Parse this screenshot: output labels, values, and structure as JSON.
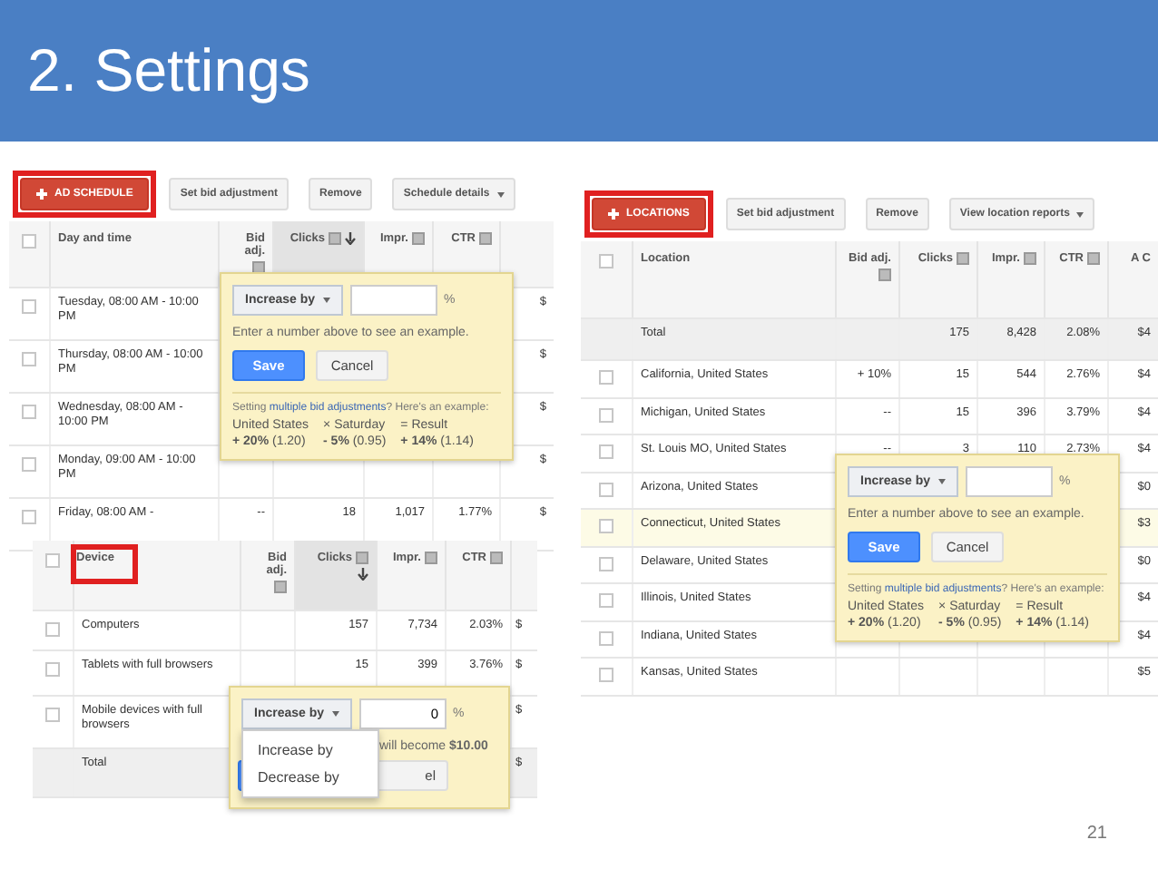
{
  "slide": {
    "title": "2. Settings",
    "page_number": "21"
  },
  "panels": [
    {
      "kind": "schedule",
      "toolbar": [
        {
          "label": "AD SCHEDULE",
          "kind": "add",
          "highlighted": true
        },
        {
          "label": "Set bid adjustment",
          "kind": "plain",
          "highlighted": false
        },
        {
          "label": "Remove",
          "kind": "plain",
          "highlighted": false
        },
        {
          "label": "Schedule details",
          "kind": "menu",
          "highlighted": false
        }
      ],
      "select_all_checked": false,
      "columns": [
        {
          "label": "Day and time",
          "help": false,
          "sorted": false,
          "highlighted": false
        },
        {
          "label": "Bid adj.",
          "help": true,
          "sorted": false,
          "highlighted": false
        },
        {
          "label": "Clicks",
          "help": true,
          "sorted": true,
          "highlighted": false
        },
        {
          "label": "Impr.",
          "help": true,
          "sorted": false,
          "highlighted": false
        },
        {
          "label": "CTR",
          "help": true,
          "sorted": false,
          "highlighted": false
        },
        {
          "help": false,
          "sorted": false,
          "highlighted": false
        }
      ],
      "rows": [
        {
          "checked": false,
          "total": false,
          "hovered": false,
          "cells": [
            "Tuesday, 08:00 AM - 10:00 PM",
            null,
            null,
            null,
            null,
            "$"
          ]
        },
        {
          "checked": false,
          "total": false,
          "hovered": false,
          "cells": [
            "Thursday, 08:00 AM - 10:00 PM",
            null,
            null,
            null,
            null,
            "$"
          ]
        },
        {
          "checked": false,
          "total": false,
          "hovered": false,
          "cells": [
            "Wednesday, 08:00 AM - 10:00 PM",
            null,
            null,
            null,
            null,
            "$"
          ]
        },
        {
          "checked": false,
          "total": false,
          "hovered": false,
          "cells": [
            "Monday, 09:00 AM - 10:00 PM",
            null,
            null,
            null,
            null,
            "$"
          ]
        },
        {
          "checked": false,
          "total": false,
          "hovered": false,
          "cells": [
            "Friday, 08:00 AM -",
            "--",
            "18",
            "1,017",
            "1.77%",
            "$"
          ]
        }
      ],
      "popup": {
        "kind": "bid",
        "select": "Increase by",
        "unit": "%",
        "hint": "Enter a number above to see an example.",
        "save": "Save",
        "cancel": "Cancel",
        "note_before": "Setting ",
        "note_link": "multiple bid adjustments",
        "note_after": "? Here's an example:",
        "example": [
          [
            "United States",
            "× Saturday",
            "= Result"
          ],
          [
            "**+ 20%** (1.20)",
            "**- 5%** (0.95)",
            "**+ 14%** (1.14)"
          ]
        ]
      }
    },
    {
      "kind": "device",
      "select_all_checked": false,
      "columns": [
        {
          "label": "Device",
          "help": false,
          "sorted": false,
          "highlighted": true
        },
        {
          "label": "Bid adj.",
          "help": true,
          "sorted": false,
          "highlighted": false
        },
        {
          "label": "Clicks",
          "help": true,
          "sorted": true,
          "highlighted": false
        },
        {
          "label": "Impr.",
          "help": true,
          "sorted": false,
          "highlighted": false
        },
        {
          "label": "CTR",
          "help": true,
          "sorted": false,
          "highlighted": false
        },
        {
          "help": false,
          "sorted": false,
          "highlighted": false
        }
      ],
      "rows": [
        {
          "checked": false,
          "total": false,
          "hovered": false,
          "cells": [
            "Computers",
            null,
            "157",
            "7,734",
            "2.03%",
            "$"
          ]
        },
        {
          "checked": false,
          "total": false,
          "hovered": false,
          "cells": [
            "Tablets with full browsers",
            null,
            "15",
            "399",
            "3.76%",
            "$"
          ]
        },
        {
          "checked": false,
          "total": false,
          "hovered": false,
          "cells": [
            "Mobile devices with full browsers",
            null,
            null,
            null,
            null,
            "$"
          ]
        },
        {
          "total": true,
          "hovered": false,
          "cells": [
            "Total",
            null,
            null,
            null,
            null,
            "$"
          ]
        }
      ],
      "popup": {
        "kind": "menu",
        "select": "Increase by",
        "value": "0",
        "unit": "%",
        "hint": "will become **$10.00**",
        "cancel": "el",
        "menu": [
          {
            "label": "Increase by",
            "selected": false
          },
          {
            "label": "Decrease by",
            "selected": false
          }
        ]
      }
    },
    {
      "kind": "locations",
      "toolbar": [
        {
          "label": "LOCATIONS",
          "kind": "add",
          "highlighted": true
        },
        {
          "label": "Set bid adjustment",
          "kind": "plain",
          "highlighted": false
        },
        {
          "label": "Remove",
          "kind": "plain",
          "highlighted": false
        },
        {
          "label": "View location reports",
          "kind": "menu",
          "highlighted": false
        }
      ],
      "select_all_checked": false,
      "columns": [
        {
          "label": "Location",
          "help": false,
          "sorted": false,
          "highlighted": false
        },
        {
          "label": "Bid adj.",
          "help": true,
          "sorted": false,
          "highlighted": false
        },
        {
          "label": "Clicks",
          "help": true,
          "sorted": false,
          "highlighted": false
        },
        {
          "label": "Impr.",
          "help": true,
          "sorted": false,
          "highlighted": false
        },
        {
          "label": "CTR",
          "help": true,
          "sorted": false,
          "highlighted": false
        },
        {
          "label": "A C",
          "help": false,
          "sorted": false,
          "highlighted": false
        }
      ],
      "rows": [
        {
          "total": true,
          "hovered": false,
          "cells": [
            "Total",
            null,
            "175",
            "8,428",
            "2.08%",
            "$4"
          ]
        },
        {
          "checked": false,
          "total": false,
          "hovered": false,
          "cells": [
            "California, United States",
            "+ 10%",
            "15",
            "544",
            "2.76%",
            "$4"
          ]
        },
        {
          "checked": false,
          "total": false,
          "hovered": false,
          "cells": [
            "Michigan, United States",
            "--",
            "15",
            "396",
            "3.79%",
            "$4"
          ]
        },
        {
          "checked": false,
          "total": false,
          "hovered": false,
          "cells": [
            "St. Louis MO, United States",
            "--",
            "3",
            "110",
            "2.73%",
            "$4"
          ]
        },
        {
          "checked": false,
          "total": false,
          "hovered": false,
          "cells": [
            "Arizona, United States",
            null,
            null,
            null,
            null,
            "$0"
          ]
        },
        {
          "checked": false,
          "total": false,
          "hovered": true,
          "cells": [
            "Connecticut, United States",
            null,
            null,
            null,
            null,
            "$3"
          ]
        },
        {
          "checked": false,
          "total": false,
          "hovered": false,
          "cells": [
            "Delaware, United States",
            null,
            null,
            null,
            null,
            "$0"
          ]
        },
        {
          "checked": false,
          "total": false,
          "hovered": false,
          "cells": [
            "Illinois, United States",
            null,
            null,
            null,
            null,
            "$4"
          ]
        },
        {
          "checked": false,
          "total": false,
          "hovered": false,
          "cells": [
            "Indiana, United States",
            null,
            null,
            null,
            null,
            "$4"
          ]
        },
        {
          "checked": false,
          "total": false,
          "hovered": false,
          "cells": [
            "Kansas, United States",
            null,
            null,
            null,
            null,
            "$5"
          ]
        }
      ],
      "popup": {
        "kind": "bid",
        "select": "Increase by",
        "unit": "%",
        "hint": "Enter a number above to see an example.",
        "save": "Save",
        "cancel": "Cancel",
        "note_before": "Setting ",
        "note_link": "multiple bid adjustments",
        "note_after": "? Here's an example:",
        "example": [
          [
            "United States",
            "× Saturday",
            "= Result"
          ],
          [
            "**+ 20%** (1.20)",
            "**- 5%** (0.95)",
            "**+ 14%** (1.14)"
          ]
        ]
      }
    }
  ]
}
